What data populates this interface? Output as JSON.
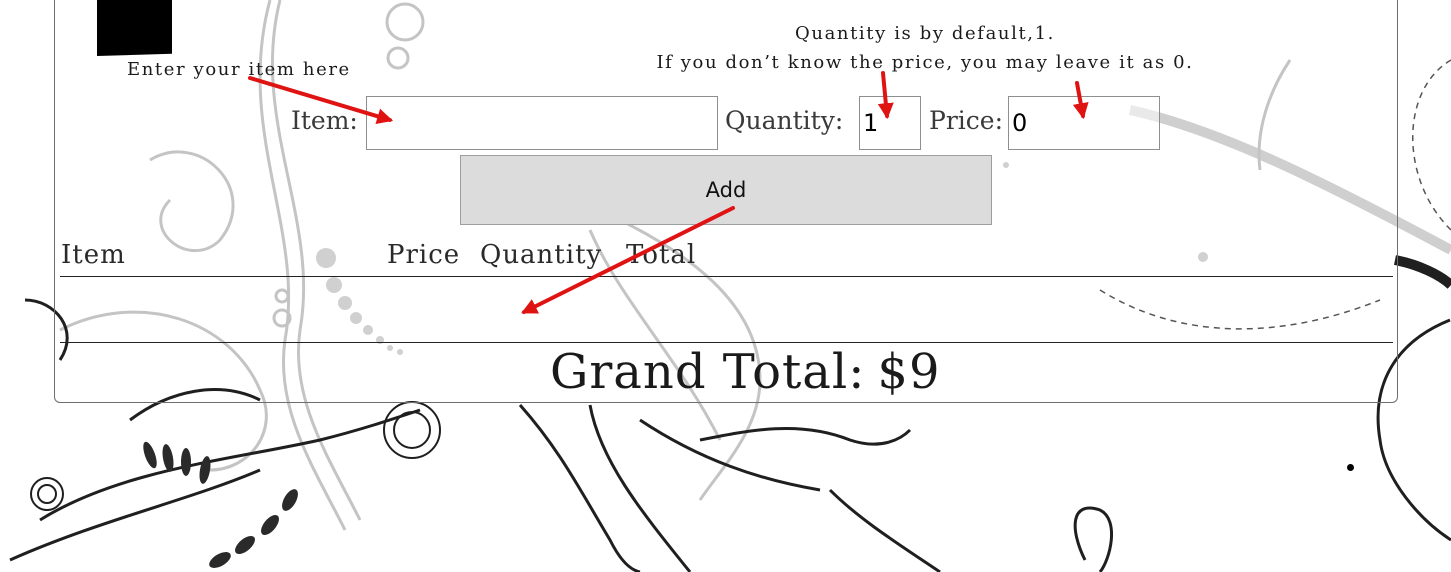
{
  "instructions": {
    "item_hint": "Enter your item here",
    "qty_hint_line1": "Quantity is by default,1.",
    "qty_hint_line2": "If you don’t know the price, you may leave it as 0."
  },
  "form": {
    "item_label": "Item:",
    "item_value": "",
    "quantity_label": "Quantity:",
    "quantity_value": "1",
    "price_label": "Price:",
    "price_value": "0",
    "add_label": "Add"
  },
  "table": {
    "columns": [
      "Item",
      "Price",
      "Quantity",
      "Total"
    ],
    "rows": []
  },
  "summary": {
    "grand_total_label": "Grand Total:",
    "grand_total_value": "$9"
  },
  "colors": {
    "annotation_arrow": "#e01313",
    "button_bg": "#dcdcdc"
  }
}
